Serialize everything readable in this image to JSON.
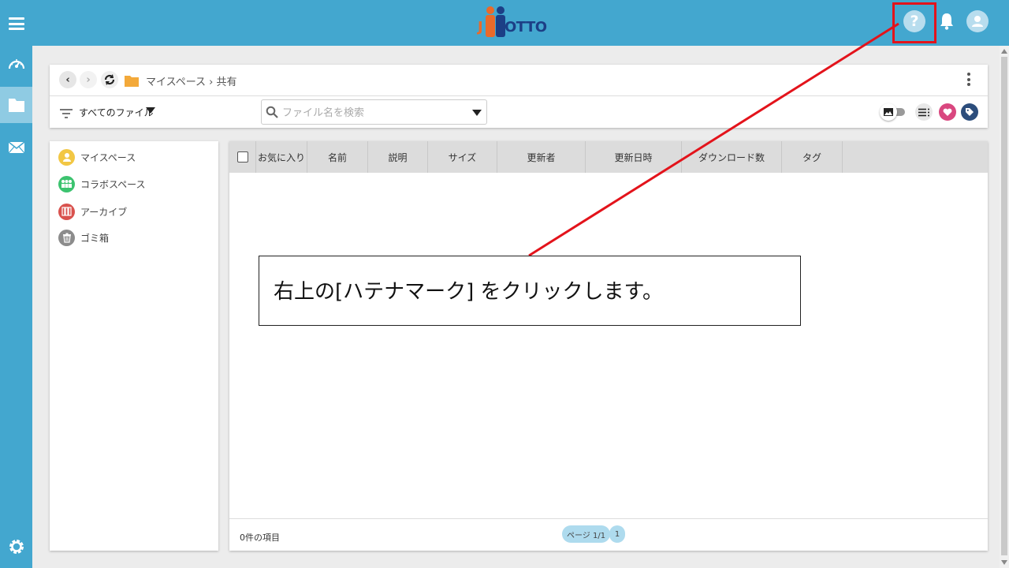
{
  "topbar": {
    "logo_prefix": "J",
    "logo_text": "OTTO",
    "help_glyph": "?",
    "icons": [
      "hamburger-menu-icon",
      "help-icon",
      "bell-icon",
      "user-icon"
    ],
    "accent_color": "#43a7cf",
    "highlight_color": "#e3131b"
  },
  "rail": {
    "items": [
      "dashboard-icon",
      "files-icon",
      "mail-icon",
      "settings-icon"
    ],
    "active": "files-icon"
  },
  "toolbar": {
    "breadcrumb": "マイスペース › 共有",
    "filter_label": "すべてのファイル",
    "search_placeholder": "ファイル名を検索"
  },
  "sidebar": {
    "items": [
      {
        "label": "マイスペース",
        "icon": "person-icon",
        "color": "#f2c744"
      },
      {
        "label": "コラボスペース",
        "icon": "group-icon",
        "color": "#3cc36f"
      },
      {
        "label": "アーカイブ",
        "icon": "archive-icon",
        "color": "#d9524e"
      },
      {
        "label": "ゴミ箱",
        "icon": "trash-icon",
        "color": "#8c8c8c"
      }
    ]
  },
  "table": {
    "columns": [
      "お気に入り",
      "名前",
      "説明",
      "サイズ",
      "更新者",
      "更新日時",
      "ダウンロード数",
      "タグ"
    ],
    "rows": [],
    "footer_count": "0件の項目",
    "page_label": "ページ 1/1",
    "page_number": "1"
  },
  "callout": {
    "text": "右上の[ハテナマーク] をクリックします。"
  }
}
